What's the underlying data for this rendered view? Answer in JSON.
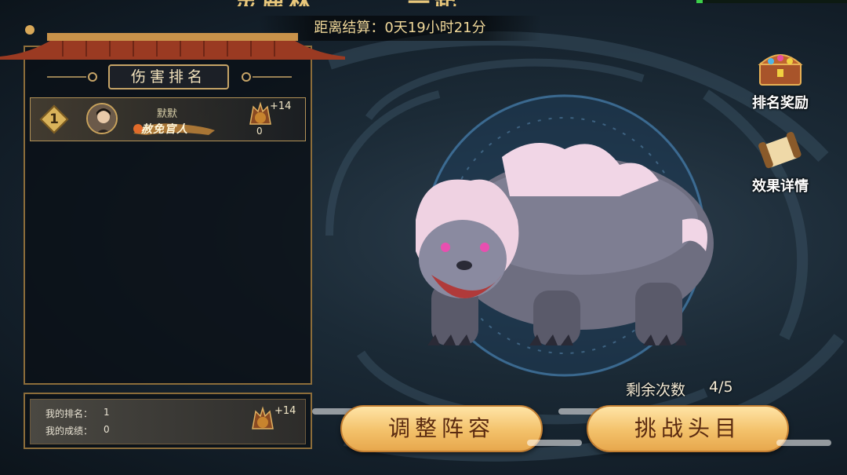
{
  "header": {
    "title_fragment_left": "灵鹿林",
    "title_fragment_right": "一起",
    "countdown_label": "距离结算：",
    "countdown_value": "0天19小时21分"
  },
  "rank_panel": {
    "title": "伤害排名",
    "rows": [
      {
        "rank": "1",
        "name": "默默",
        "title_badge": "赦免官人",
        "bonus": "+14",
        "count": "0"
      }
    ]
  },
  "my_rank": {
    "rank_label": "我的排名：",
    "rank_value": "1",
    "score_label": "我的成绩：",
    "score_value": "0",
    "bonus": "+14"
  },
  "side_buttons": {
    "rank_reward": "排名奖励",
    "effect_detail": "效果详情"
  },
  "boss": {
    "remaining_label": "剩余次数",
    "remaining_value": "4/5"
  },
  "actions": {
    "adjust_lineup": "调整阵容",
    "challenge_boss": "挑战头目"
  },
  "colors": {
    "accent_gold": "#c6a467",
    "button_top": "#ffe4a6",
    "button_text": "#5a2a10",
    "panel_border": "#8c6d3a"
  },
  "icons": {
    "treasure": "treasure-chest-icon",
    "scroll": "scroll-icon",
    "beast_badge": "beast-head-icon"
  }
}
